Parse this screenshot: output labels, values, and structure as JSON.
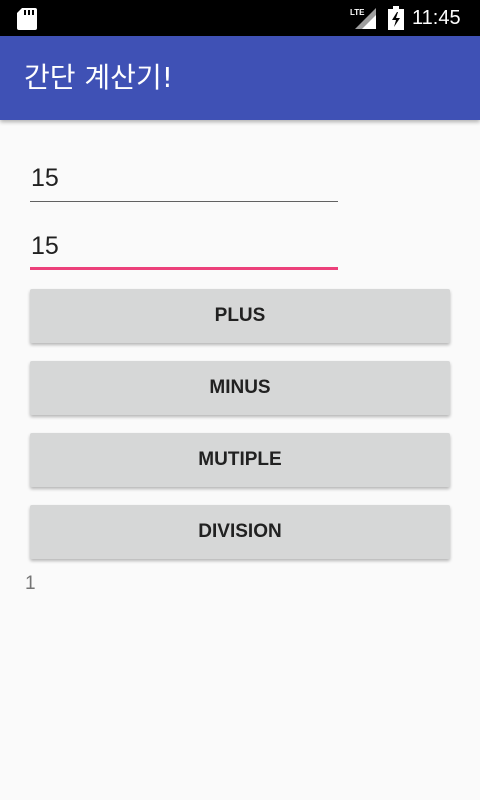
{
  "status_bar": {
    "time": "11:45",
    "network_label": "LTE",
    "icons": [
      "sd-card-icon",
      "lte-signal-icon",
      "battery-charging-icon"
    ]
  },
  "app_bar": {
    "title": "간단 계산기!",
    "color": "#3f51b5"
  },
  "inputs": {
    "first_value": "15",
    "second_value": "15",
    "focused_underline_color": "#ec407a"
  },
  "buttons": {
    "plus_label": "PLUS",
    "minus_label": "MINUS",
    "multiply_label": "MUTIPLE",
    "division_label": "DIVISION",
    "background": "#d6d7d7"
  },
  "result": {
    "value": "1"
  }
}
